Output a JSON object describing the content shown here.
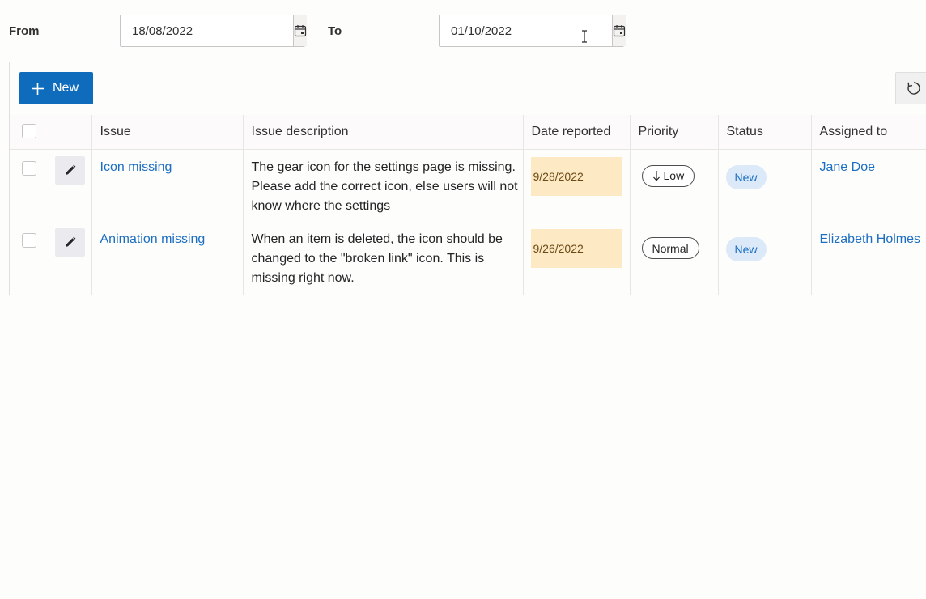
{
  "filters": {
    "from_label": "From",
    "from_value": "18/08/2022",
    "to_label": "To",
    "to_value": "01/10/2022"
  },
  "toolbar": {
    "new_label": "New"
  },
  "table": {
    "columns": [
      "Issue",
      "Issue description",
      "Date reported",
      "Priority",
      "Status",
      "Assigned to"
    ],
    "rows": [
      {
        "issue": "Icon missing",
        "description": "The gear icon for the settings page is missing. Please add the correct icon, else users will not know where the settings",
        "date_reported": "9/28/2022",
        "priority": "Low",
        "priority_icon": "arrow-down-icon",
        "status": "New",
        "assigned_to": "Jane Doe"
      },
      {
        "issue": "Animation missing",
        "description": "When an item is deleted, the icon should be changed to the \"broken link\" icon. This is missing right now.",
        "date_reported": "9/26/2022",
        "priority": "Normal",
        "status": "New",
        "assigned_to": "Elizabeth Holmes"
      }
    ]
  },
  "colors": {
    "accent": "#0f6cbd",
    "link": "#1b6ec2",
    "date_chip_bg": "#fde9c4",
    "status_bg": "#dbe9f9"
  }
}
